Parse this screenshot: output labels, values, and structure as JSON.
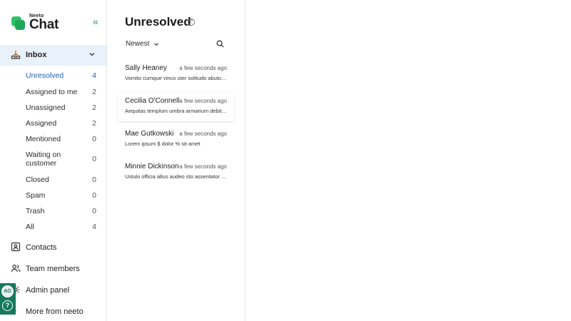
{
  "brand": {
    "small": "Neeto",
    "big": "Chat"
  },
  "sidebar": {
    "inbox_label": "Inbox",
    "sub_items": [
      {
        "label": "Unresolved",
        "count": "4"
      },
      {
        "label": "Assigned to me",
        "count": "2"
      },
      {
        "label": "Unassigned",
        "count": "2"
      },
      {
        "label": "Assigned",
        "count": "2"
      },
      {
        "label": "Mentioned",
        "count": "0"
      },
      {
        "label": "Waiting on customer",
        "count": "0"
      },
      {
        "label": "Closed",
        "count": "0"
      },
      {
        "label": "Spam",
        "count": "0"
      },
      {
        "label": "Trash",
        "count": "0"
      },
      {
        "label": "All",
        "count": "4"
      }
    ],
    "nav": [
      {
        "label": "Contacts",
        "icon": "contacts-icon"
      },
      {
        "label": "Team members",
        "icon": "team-icon"
      },
      {
        "label": "Admin panel",
        "icon": "settings-icon"
      },
      {
        "label": "More from neeto",
        "icon": "more-icon"
      }
    ],
    "user_initials": "AO"
  },
  "list": {
    "title": "Unresolved",
    "sort_label": "Newest",
    "conversations": [
      {
        "name": "Sally Heaney",
        "time": "a few seconds ago",
        "preview": "Vomito cumque vinco uter solitudo abutor thermae."
      },
      {
        "name": "Cecilia O'Connell",
        "time": "a few seconds ago",
        "preview": "Aequitas templum umbra armarium debitis voluptas."
      },
      {
        "name": "Mae Gutkowski",
        "time": "a few seconds ago",
        "preview": "Lorem ipsum $ dolor % sit amet"
      },
      {
        "name": "Minnie Dickinson",
        "time": "a few seconds ago",
        "preview": "Ustulo officia altus audeo sto assentator cupio."
      }
    ]
  },
  "colors": {
    "brand_green": "#2cc36b",
    "active_blue": "#1d5fb8",
    "inbox_bg": "#e9f1fb",
    "avatar_strip": "#17795b"
  }
}
